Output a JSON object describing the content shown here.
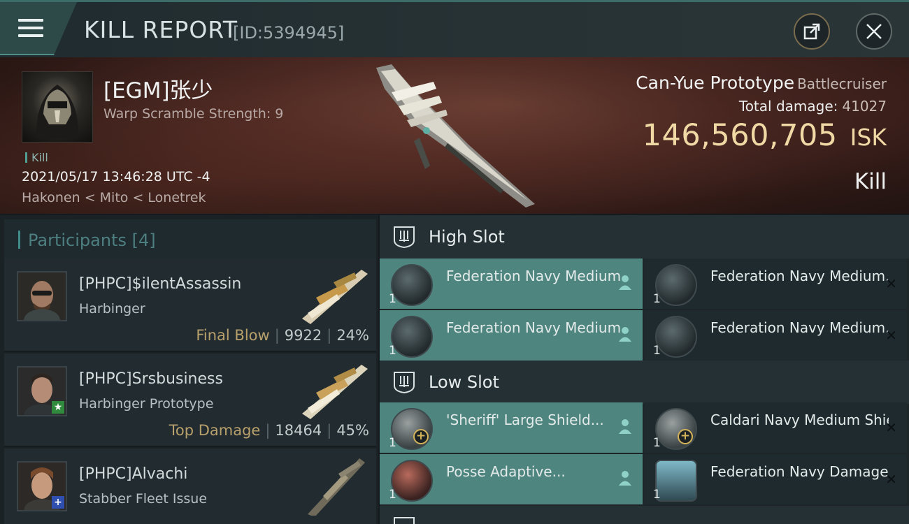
{
  "header": {
    "title": "KILL REPORT",
    "report_id": "[ID:5394945]",
    "icons": {
      "menu": "hamburger-icon",
      "share": "share-icon",
      "close": "close-icon"
    }
  },
  "victim": {
    "pilot_name": "[EGM]张少",
    "warp_scramble": "Warp Scramble Strength: 9",
    "kill_tag": "Kill",
    "datetime": "2021/05/17 13:46:28 UTC -4",
    "location": "Hakonen < Mito < Lonetrek",
    "ship_name": "Can-Yue Prototype",
    "ship_class": "Battlecruiser",
    "total_damage_label": "Total damage:",
    "total_damage": "41027",
    "isk_value": "146,560,705",
    "isk_unit": "ISK",
    "result": "Kill"
  },
  "participants": {
    "title": "Participants",
    "count": "[4]",
    "items": [
      {
        "name": "[PHPC]$ilentAssassin",
        "ship": "Harbinger",
        "role": "Final Blow",
        "damage": "9922",
        "percent": "24%",
        "badge": ""
      },
      {
        "name": "[PHPC]Srsbusiness",
        "ship": "Harbinger Prototype",
        "role": "Top Damage",
        "damage": "18464",
        "percent": "45%",
        "badge": "★"
      },
      {
        "name": "[PHPC]Alvachi",
        "ship": "Stabber Fleet Issue",
        "role": "",
        "damage": "",
        "percent": "",
        "badge": "+"
      }
    ]
  },
  "fitting": {
    "high_slot": {
      "title": "High Slot",
      "modules": [
        {
          "name": "Federation Navy Medium...",
          "qty": "1",
          "state": "destroyed"
        },
        {
          "name": "Federation Navy Medium...",
          "qty": "1",
          "state": "dropped"
        },
        {
          "name": "Federation Navy Medium...",
          "qty": "1",
          "state": "destroyed"
        },
        {
          "name": "Federation Navy Medium...",
          "qty": "1",
          "state": "dropped"
        }
      ]
    },
    "low_slot": {
      "title": "Low Slot",
      "modules": [
        {
          "name": "'Sheriff' Large Shield...",
          "qty": "1",
          "state": "destroyed"
        },
        {
          "name": "Caldari Navy Medium Shield ...",
          "qty": "1",
          "state": "dropped"
        },
        {
          "name": "Posse Adaptive...",
          "qty": "1",
          "state": "destroyed"
        },
        {
          "name": "Federation Navy Damage...",
          "qty": "1",
          "state": "dropped"
        }
      ]
    }
  },
  "colors": {
    "accent": "#4f857f",
    "isk": "#f0d9a4",
    "role": "#b8a06c"
  }
}
